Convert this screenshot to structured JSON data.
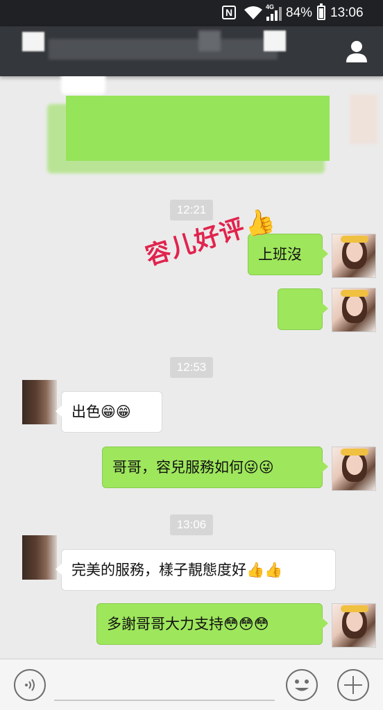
{
  "status_bar": {
    "nfc": "N",
    "network": "4G",
    "battery_percent": "84%",
    "time": "13:06"
  },
  "header": {
    "profile_icon": "person-icon"
  },
  "messages": {
    "time_1": "12:21",
    "msg_1": "上班沒",
    "time_2": "12:53",
    "msg_2": "出色😁😁",
    "msg_3": "哥哥，容兒服務如何😜😜",
    "time_3": "13:06",
    "msg_4": "完美的服務，樣子靚態度好👍👍",
    "msg_5": "多謝哥哥大力支持😳😳😳"
  },
  "watermark": "容儿好评👍",
  "input_bar": {
    "voice_icon": "voice-icon",
    "emoji_icon": "smiley-icon",
    "more_icon": "plus-icon"
  },
  "colors": {
    "header": "#34373b",
    "background": "#ebebeb",
    "bubble_green": "#9ee65c",
    "bubble_white": "#ffffff",
    "watermark": "#e0244e"
  }
}
